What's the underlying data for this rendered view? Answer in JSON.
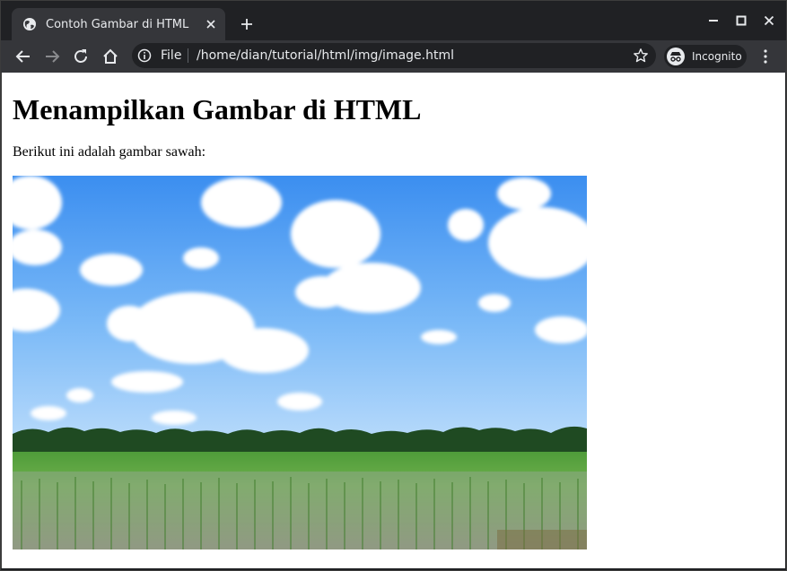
{
  "browser": {
    "tab": {
      "title": "Contoh Gambar di HTML",
      "favicon": "globe-icon"
    },
    "omnibox": {
      "scheme_label": "File",
      "url": "/home/dian/tutorial/html/img/image.html"
    },
    "profile_label": "Incognito",
    "colors": {
      "frame": "#202124",
      "toolbar": "#35363a",
      "text": "#e8eaed"
    }
  },
  "page": {
    "heading": "Menampilkan Gambar di HTML",
    "paragraph": "Berikut ini adalah gambar sawah:",
    "image": {
      "subject": "rice-field-landscape"
    }
  }
}
